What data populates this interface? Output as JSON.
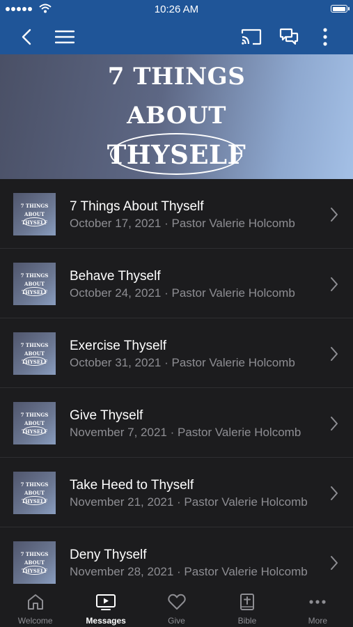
{
  "status_bar": {
    "time": "10:26 AM"
  },
  "banner": {
    "line1": "7 THINGS",
    "line2": "ABOUT",
    "line3": "THYSELF"
  },
  "thumbnail": {
    "line1": "7 THINGS",
    "line2": "ABOUT",
    "line3": "THYSELF"
  },
  "messages": [
    {
      "title": "7 Things About Thyself",
      "subtitle": "October 17, 2021 · Pastor Valerie Holcomb"
    },
    {
      "title": "Behave Thyself",
      "subtitle": "October 24, 2021 · Pastor Valerie Holcomb"
    },
    {
      "title": "Exercise Thyself",
      "subtitle": "October 31, 2021 · Pastor Valerie Holcomb"
    },
    {
      "title": "Give Thyself",
      "subtitle": "November 7, 2021 · Pastor Valerie Holcomb"
    },
    {
      "title": "Take Heed to Thyself",
      "subtitle": "November 21, 2021 · Pastor Valerie Holcomb"
    },
    {
      "title": "Deny Thyself",
      "subtitle": "November 28, 2021 · Pastor Valerie Holcomb"
    }
  ],
  "tabs": [
    {
      "label": "Welcome",
      "icon": "home-icon",
      "active": false
    },
    {
      "label": "Messages",
      "icon": "tv-icon",
      "active": true
    },
    {
      "label": "Give",
      "icon": "heart-icon",
      "active": false
    },
    {
      "label": "Bible",
      "icon": "bible-icon",
      "active": false
    },
    {
      "label": "More",
      "icon": "more-icon",
      "active": false
    }
  ],
  "colors": {
    "header": "#1f5598",
    "background": "#1c1c1e",
    "secondary_text": "#8e8e93"
  }
}
